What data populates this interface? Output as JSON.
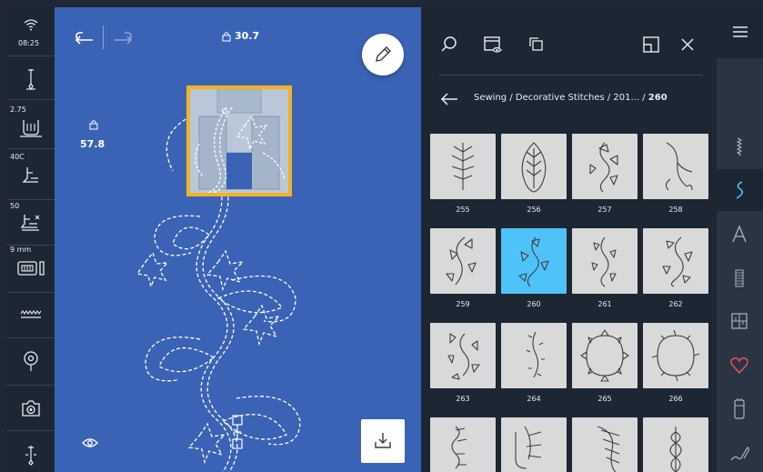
{
  "status_bar": {
    "time": "08:25",
    "stitch_width": "2.75",
    "thread_tension": "40C",
    "presser_foot_pressure": "50",
    "needle_size": "9 mm"
  },
  "canvas": {
    "height_value": "30.7",
    "width_value": "57.8"
  },
  "panel": {
    "breadcrumb_path": "Sewing / Decorative Stitches / 201... / ",
    "breadcrumb_current": "260",
    "patterns": [
      {
        "number": "255",
        "selected": false
      },
      {
        "number": "256",
        "selected": false
      },
      {
        "number": "257",
        "selected": false
      },
      {
        "number": "258",
        "selected": false
      },
      {
        "number": "259",
        "selected": false
      },
      {
        "number": "260",
        "selected": true
      },
      {
        "number": "261",
        "selected": false
      },
      {
        "number": "262",
        "selected": false
      },
      {
        "number": "263",
        "selected": false
      },
      {
        "number": "264",
        "selected": false
      },
      {
        "number": "265",
        "selected": false
      },
      {
        "number": "266",
        "selected": false
      },
      {
        "number": "",
        "selected": false
      },
      {
        "number": "",
        "selected": false
      },
      {
        "number": "",
        "selected": false
      },
      {
        "number": "",
        "selected": false
      }
    ]
  },
  "rail": {
    "categories": [
      "practical-stitches-icon",
      "decorative-stitches-icon",
      "alphabets-icon",
      "buttonholes-icon",
      "quilt-stitches-icon",
      "favorites-icon",
      "bobbin-icon",
      "stitch-designer-icon"
    ]
  },
  "colors": {
    "canvas_blue": "#3a63b5",
    "highlight_yellow": "#f4b321",
    "selected_tile": "#4fc3f7",
    "favorites_red": "#e0555f",
    "dark_panel": "#1d2633"
  }
}
